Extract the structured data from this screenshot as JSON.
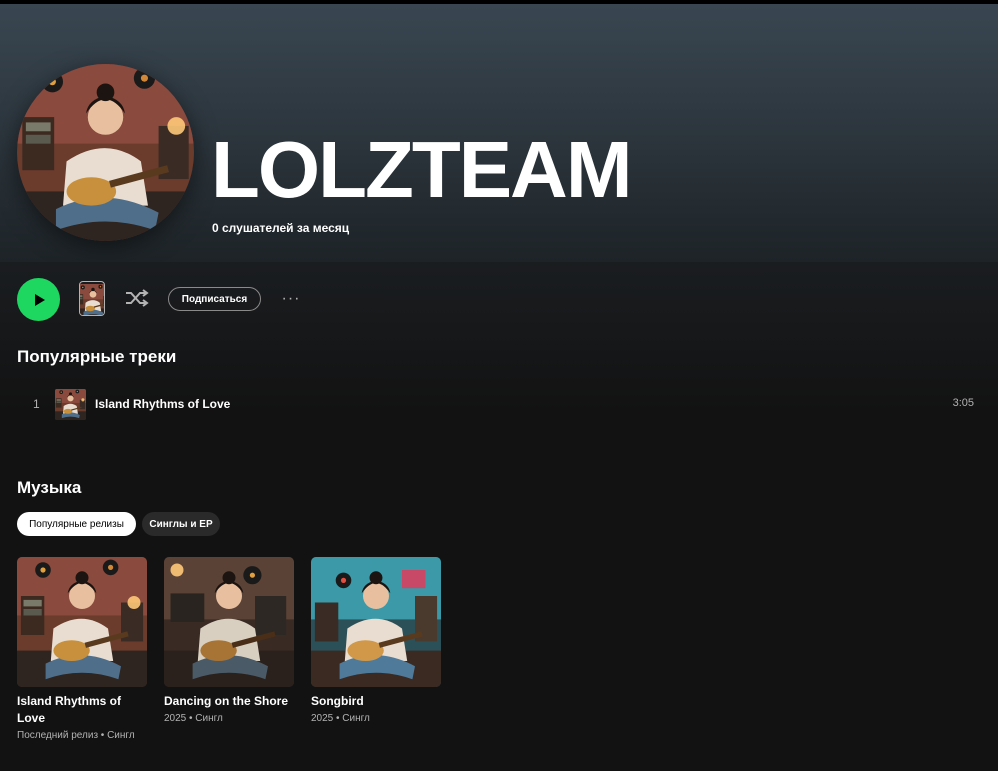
{
  "artist": {
    "name": "LOLZTEAM",
    "listeners": "0 слушателей за месяц"
  },
  "actions": {
    "follow_label": "Подписаться",
    "more_label": "···"
  },
  "popular": {
    "title": "Популярные треки",
    "tracks": [
      {
        "number": "1",
        "title": "Island Rhythms of Love",
        "duration": "3:05"
      }
    ]
  },
  "music": {
    "title": "Музыка",
    "filters": [
      "Популярные релизы",
      "Синглы и EP"
    ],
    "releases": [
      {
        "title": "Island Rhythms of Love",
        "subtitle": "Последний релиз • Сингл"
      },
      {
        "title": "Dancing on the Shore",
        "subtitle": "2025 • Сингл"
      },
      {
        "title": "Songbird",
        "subtitle": "2025 • Сингл"
      }
    ]
  },
  "colors": {
    "accent": "#1ed760",
    "background": "#121212",
    "hero_top": "#394651"
  }
}
